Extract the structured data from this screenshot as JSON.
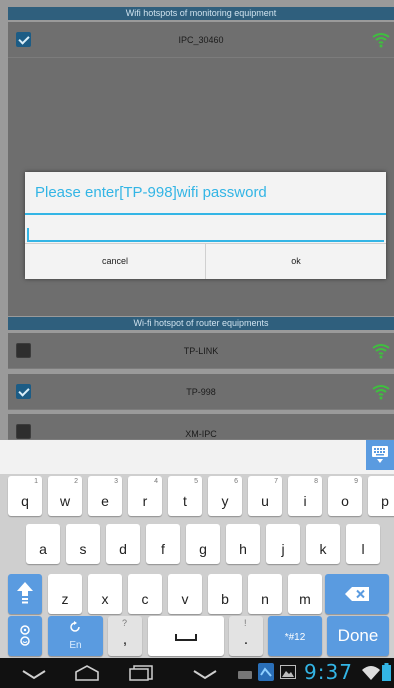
{
  "monitoring_header": "Wifi hotspots of monitoring equipment",
  "monitoring_devices": [
    {
      "name": "IPC_30460",
      "checked": true
    }
  ],
  "router_header": "Wi-fi hotspot of router equipments",
  "router_devices": [
    {
      "name": "TP-LINK",
      "checked": false
    },
    {
      "name": "TP-998",
      "checked": true
    },
    {
      "name": "XM-IPC",
      "checked": false
    }
  ],
  "dialog": {
    "title": "Please enter[TP-998]wifi password",
    "password_value": "",
    "cancel_label": "cancel",
    "ok_label": "ok"
  },
  "keyboard": {
    "row1": [
      {
        "k": "q",
        "h": "1"
      },
      {
        "k": "w",
        "h": "2"
      },
      {
        "k": "e",
        "h": "3"
      },
      {
        "k": "r",
        "h": "4"
      },
      {
        "k": "t",
        "h": "5"
      },
      {
        "k": "y",
        "h": "6"
      },
      {
        "k": "u",
        "h": "7"
      },
      {
        "k": "i",
        "h": "8"
      },
      {
        "k": "o",
        "h": "9"
      },
      {
        "k": "p",
        "h": ""
      }
    ],
    "row2": [
      "a",
      "s",
      "d",
      "f",
      "g",
      "h",
      "j",
      "k",
      "l"
    ],
    "row3": [
      "z",
      "x",
      "c",
      "v",
      "b",
      "n",
      "m"
    ],
    "lang_label": "En",
    "comma_hint": "?",
    "comma_label": ",",
    "period_hint": "!",
    "period_label": ".",
    "symbols_label": "*#12",
    "done_label": "Done"
  },
  "status": {
    "time": "9:37"
  },
  "colors": {
    "accent": "#33b5e5",
    "wifi_green": "#3fbf3f",
    "key_blue": "#5a9be0"
  }
}
